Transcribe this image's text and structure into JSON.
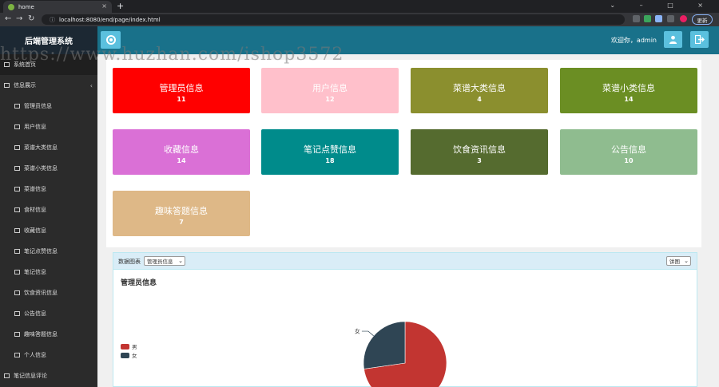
{
  "browser": {
    "tab_title": "home",
    "tab_close": "×",
    "new_tab": "+",
    "url": "localhost:8080/end/page/index.html",
    "update_label": "更新",
    "window_controls": "⌄ – □ ×"
  },
  "header": {
    "brand": "后端管理系统",
    "welcome": "欢迎你，admin"
  },
  "watermark": "https://www.huzhan.com/ishop3572",
  "sidebar": {
    "items": [
      {
        "label": "系统首页",
        "icon": "home-icon",
        "kind": "top"
      },
      {
        "label": "信息展示",
        "icon": "sitemap-icon",
        "kind": "group",
        "caret": "‹"
      },
      {
        "label": "管理员信息",
        "icon": "table-icon",
        "kind": "sub"
      },
      {
        "label": "用户信息",
        "icon": "table-icon",
        "kind": "sub"
      },
      {
        "label": "菜谱大类信息",
        "icon": "table-icon",
        "kind": "sub"
      },
      {
        "label": "菜谱小类信息",
        "icon": "table-icon",
        "kind": "sub"
      },
      {
        "label": "菜谱信息",
        "icon": "table-icon",
        "kind": "sub"
      },
      {
        "label": "食材信息",
        "icon": "table-icon",
        "kind": "sub"
      },
      {
        "label": "收藏信息",
        "icon": "table-icon",
        "kind": "sub"
      },
      {
        "label": "笔记点赞信息",
        "icon": "table-icon",
        "kind": "sub"
      },
      {
        "label": "笔记信息",
        "icon": "table-icon",
        "kind": "sub"
      },
      {
        "label": "饮食资讯信息",
        "icon": "table-icon",
        "kind": "sub"
      },
      {
        "label": "公告信息",
        "icon": "table-icon",
        "kind": "sub"
      },
      {
        "label": "趣味答题信息",
        "icon": "table-icon",
        "kind": "sub"
      },
      {
        "label": "个人信息",
        "icon": "user-icon",
        "kind": "sub"
      },
      {
        "label": "笔记信息评论",
        "icon": "file-icon",
        "kind": "group"
      }
    ]
  },
  "cards": [
    {
      "title": "管理员信息",
      "count": "11",
      "color": "#ff0000"
    },
    {
      "title": "用户信息",
      "count": "12",
      "color": "#ffc0cb"
    },
    {
      "title": "菜谱大类信息",
      "count": "4",
      "color": "#8b8f2e"
    },
    {
      "title": "菜谱小类信息",
      "count": "14",
      "color": "#6b8e23"
    },
    {
      "title": "收藏信息",
      "count": "14",
      "color": "#da70d6"
    },
    {
      "title": "笔记点赞信息",
      "count": "18",
      "color": "#008b8b"
    },
    {
      "title": "饮食资讯信息",
      "count": "3",
      "color": "#556b2f"
    },
    {
      "title": "公告信息",
      "count": "10",
      "color": "#8fbc8f"
    },
    {
      "title": "趣味答题信息",
      "count": "7",
      "color": "#deb887"
    }
  ],
  "panel": {
    "label": "数据图表",
    "select_value": "管理员信息",
    "chart_type_value": "饼图"
  },
  "chart_data": {
    "type": "pie",
    "title": "管理员信息",
    "slices": [
      {
        "name": "男",
        "value": 8,
        "color": "#c23531"
      },
      {
        "name": "女",
        "value": 3,
        "color": "#2f4554"
      }
    ],
    "legend": "left"
  }
}
